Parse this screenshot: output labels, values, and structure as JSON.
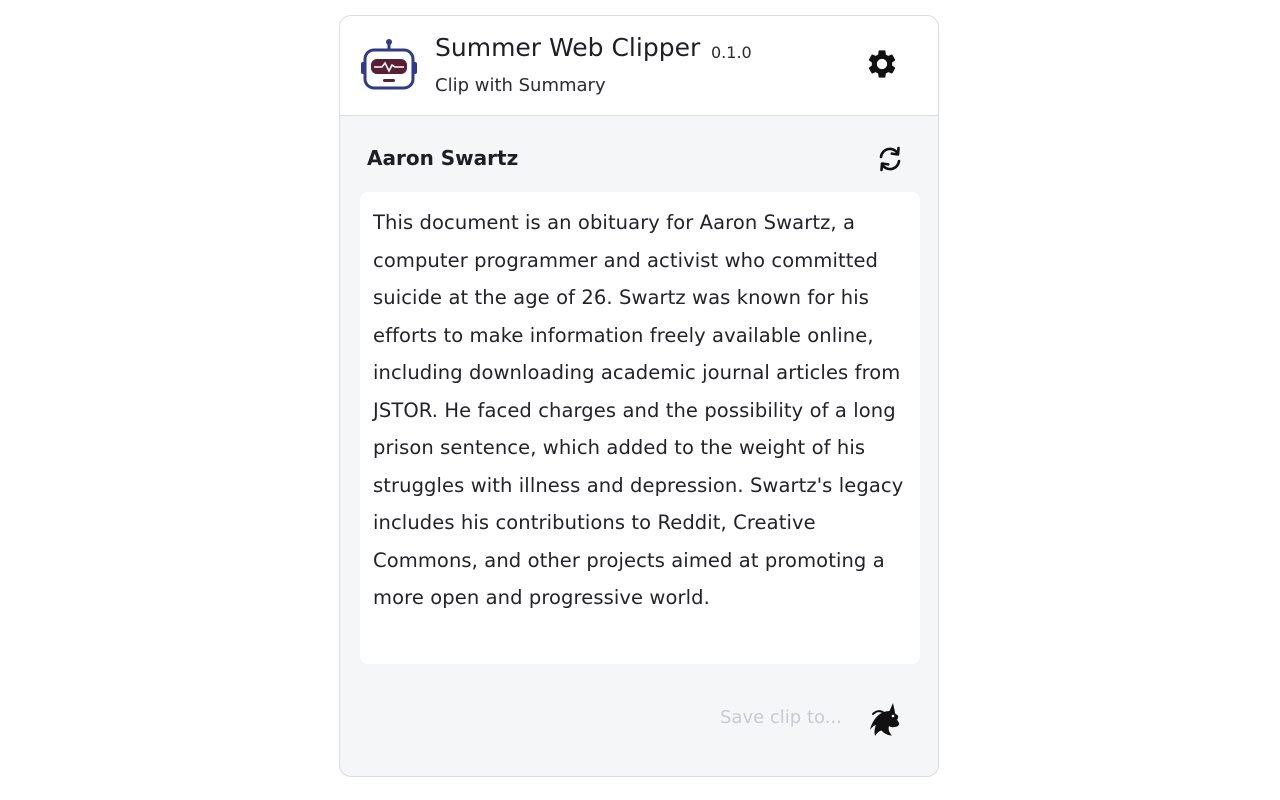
{
  "header": {
    "title": "Summer Web Clipper",
    "version": "0.1.0",
    "subtitle": "Clip with Summary",
    "logo_icon": "robot-icon",
    "settings_icon": "gear-icon"
  },
  "document": {
    "title": "Aaron Swartz",
    "refresh_icon": "refresh-icon",
    "summary": "This document is an obituary for Aaron Swartz, a computer programmer and activist who committed suicide at the age of 26. Swartz was known for his efforts to make information freely available online, including downloading academic journal articles from JSTOR. He faced charges and the possibility of a long prison sentence, which added to the weight of his struggles with illness and depression. Swartz's legacy includes his contributions to Reddit, Creative Commons, and other projects aimed at promoting a more open and progressive world."
  },
  "footer": {
    "save_label": "Save clip to...",
    "target_icon": "unicorn-icon"
  },
  "colors": {
    "robot_outline": "#2f3a8f",
    "robot_visor": "#5a1f36",
    "border": "#d9dce1",
    "panel_bg": "#f5f6f8",
    "save_text": "#c7cad0"
  }
}
